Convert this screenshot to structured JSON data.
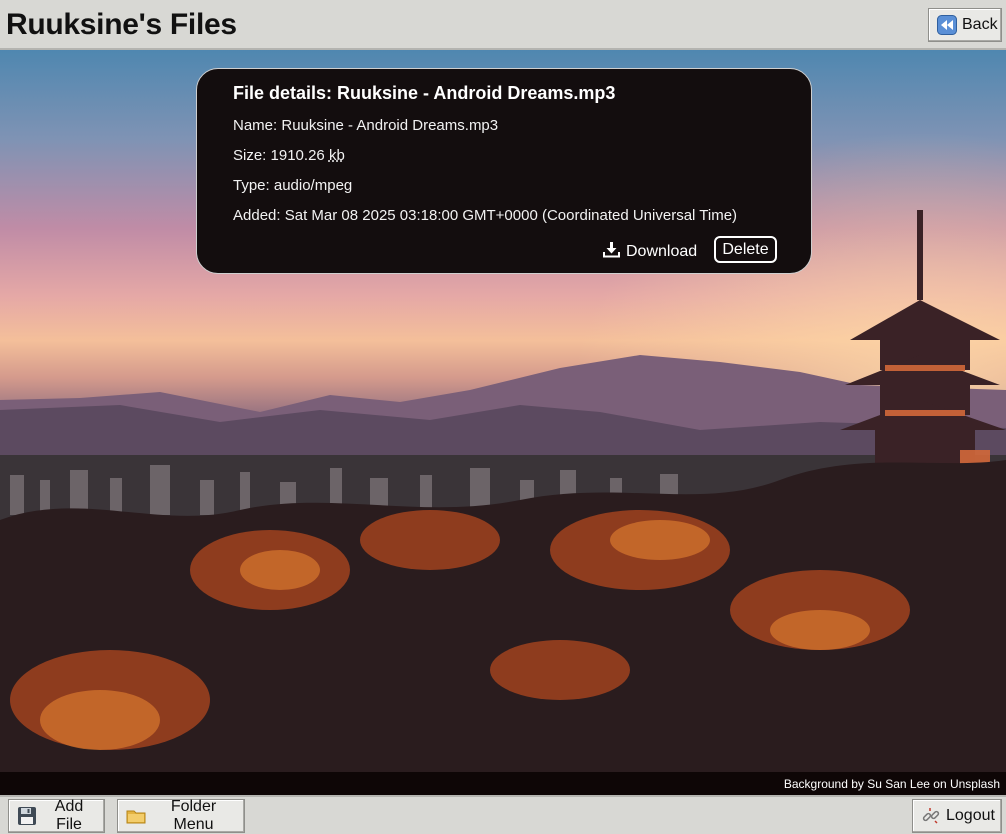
{
  "header": {
    "title": "Ruuksine's Files",
    "back_label": "Back"
  },
  "file_details": {
    "heading": "File details: Ruuksine - Android Dreams.mp3",
    "name_label": "Name:",
    "name_value": "Ruuksine - Android Dreams.mp3",
    "size_label": "Size:",
    "size_number": "1910.26",
    "size_unit": "kb",
    "type_label": "Type:",
    "type_value": "audio/mpeg",
    "added_label": "Added:",
    "added_value": "Sat Mar 08 2025 03:18:00 GMT+0000 (Coordinated Universal Time)",
    "download_label": "Download",
    "delete_label": "Delete"
  },
  "background": {
    "credit": "Background by Su San Lee on Unsplash"
  },
  "footer": {
    "add_file_label": "Add File",
    "folder_menu_label": "Folder Menu",
    "logout_label": "Logout"
  },
  "icons": {
    "back": "rewind-icon",
    "download": "download-icon",
    "add_file": "floppy-disk-icon",
    "folder_menu": "folder-icon",
    "logout": "broken-link-icon"
  },
  "colors": {
    "card_bg": "#130d0e",
    "toolbar_bg": "#d8d8d4",
    "text_dark": "#111111"
  }
}
